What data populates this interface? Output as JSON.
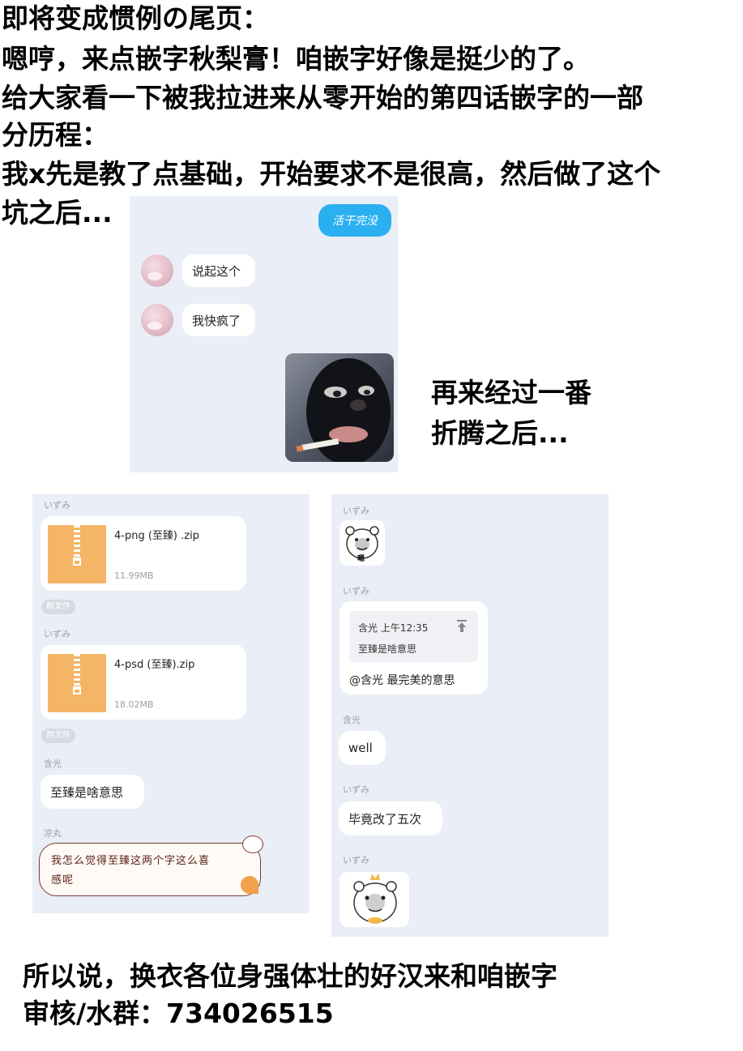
{
  "header_lines": [
    "即将变成惯例の尾页：",
    "嗯哼，来点嵌字秋梨膏！咱嵌字好像是挺少的了。",
    "给大家看一下被我拉进来从零开始的第四话嵌字的一部",
    "分历程：",
    "我x先是教了点基础，开始要求不是很高，然后做了这个",
    "坑之后..."
  ],
  "side_caption": [
    "再来经过一番",
    "折腾之后..."
  ],
  "chat1": {
    "sent_bubble": "活干完没",
    "messages": [
      {
        "text": "说起这个"
      },
      {
        "text": "我快疯了"
      }
    ],
    "image_icon": "masked-face-photo"
  },
  "chat2": {
    "user1": "いずみ",
    "file1_name": "4-png (至臻) .zip",
    "file1_size": "11.99MB",
    "tag1": "群文件",
    "user2": "いずみ",
    "file2_name": "4-psd (至臻).zip",
    "file2_size": "18.02MB",
    "tag2": "群文件",
    "user3": "含光",
    "msg3": "至臻是啥意思",
    "user4": "凉丸",
    "msg4_line1": "我怎么觉得至臻这两个字这么喜",
    "msg4_line2": "感呢"
  },
  "chat3": {
    "user1": "いずみ",
    "sticker1_text": "嗯",
    "user2": "いずみ",
    "quote_meta": "含光 上午12:35",
    "quote_text": "至臻是啥意思",
    "reply_text": "@含光 最完美的意思",
    "user3": "含光",
    "msg3": "well",
    "user4": "いずみ",
    "msg4": "毕竟改了五次",
    "user5": "いずみ"
  },
  "footer_lines": [
    "所以说，换衣各位身强体壮的好汉来和咱嵌字",
    "审核/水群：734026515"
  ],
  "colors": {
    "panel_bg": "#eaeef6",
    "sent_bubble": "#2ab0f0",
    "zip_orange": "#f4b566"
  }
}
